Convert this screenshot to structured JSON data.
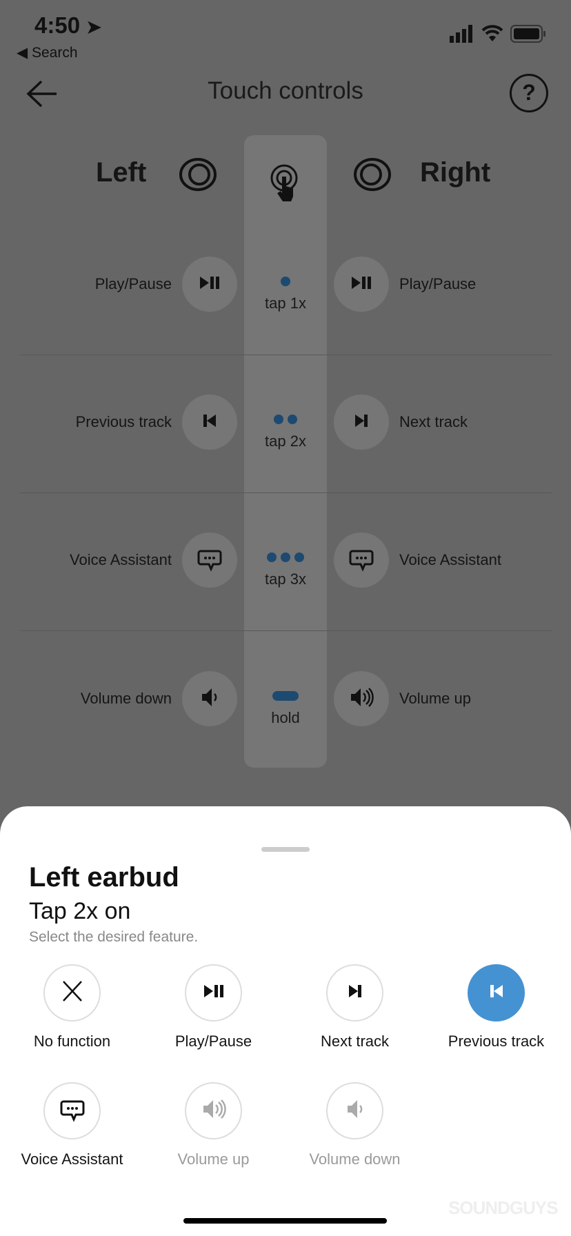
{
  "status": {
    "time": "4:50",
    "back_label": "Search"
  },
  "header": {
    "title": "Touch controls"
  },
  "columns": {
    "left": "Left",
    "right": "Right"
  },
  "rows": [
    {
      "gesture": "tap 1x",
      "dots": 1,
      "left": "Play/Pause",
      "right": "Play/Pause",
      "left_icon": "play-pause-icon",
      "right_icon": "play-pause-icon"
    },
    {
      "gesture": "tap 2x",
      "dots": 2,
      "left": "Previous track",
      "right": "Next track",
      "left_icon": "previous-track-icon",
      "right_icon": "next-track-icon"
    },
    {
      "gesture": "tap 3x",
      "dots": 3,
      "left": "Voice Assistant",
      "right": "Voice Assistant",
      "left_icon": "voice-assistant-icon",
      "right_icon": "voice-assistant-icon"
    },
    {
      "gesture": "hold",
      "dots": 0,
      "left": "Volume down",
      "right": "Volume up",
      "left_icon": "volume-down-icon",
      "right_icon": "volume-up-icon"
    }
  ],
  "sheet": {
    "title": "Left earbud",
    "subtitle": "Tap 2x on",
    "hint": "Select the desired feature.",
    "options": [
      {
        "label": "No function",
        "icon": "close-icon",
        "selected": false,
        "disabled": false
      },
      {
        "label": "Play/Pause",
        "icon": "play-pause-icon",
        "selected": false,
        "disabled": false
      },
      {
        "label": "Next track",
        "icon": "next-track-icon",
        "selected": false,
        "disabled": false
      },
      {
        "label": "Previous track",
        "icon": "previous-track-icon",
        "selected": true,
        "disabled": false
      },
      {
        "label": "Voice Assistant",
        "icon": "voice-assistant-icon",
        "selected": false,
        "disabled": false
      },
      {
        "label": "Volume up",
        "icon": "volume-up-icon",
        "selected": false,
        "disabled": true
      },
      {
        "label": "Volume down",
        "icon": "volume-down-icon",
        "selected": false,
        "disabled": true
      }
    ]
  },
  "watermark": "SOUNDGUYS",
  "colors": {
    "accent": "#4592d2",
    "overlay": "#666666"
  }
}
